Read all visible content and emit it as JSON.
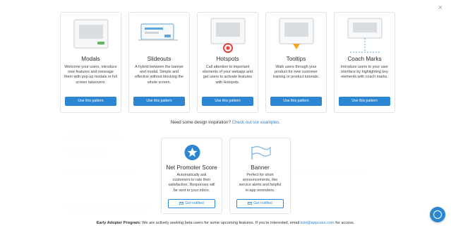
{
  "close_label": "×",
  "patterns": [
    {
      "title": "Modals",
      "desc": "Welcome your users, introduce new features and message them with pop-up modals or full screen takeovers.",
      "button": "Use this pattern",
      "icon": "modal-illustration"
    },
    {
      "title": "Slideouts",
      "desc": "A hybrid between the banner and modal. Simple and effective without blocking the whole screen.",
      "button": "Use this pattern",
      "icon": "slideout-illustration"
    },
    {
      "title": "Hotspots",
      "desc": "Call attention to important elements of your webapp and get users to activate features with Hotspots.",
      "button": "Use this pattern",
      "icon": "hotspot-illustration"
    },
    {
      "title": "Tooltips",
      "desc": "Walk users through your product for new customer training or product tutorials.",
      "button": "Use this pattern",
      "icon": "tooltip-illustration"
    },
    {
      "title": "Coach Marks",
      "desc": "Introduce users to your user interface by highlighting key elements with coach marks.",
      "button": "Use this pattern",
      "icon": "coach-marks-illustration"
    }
  ],
  "inspiration": {
    "prefix": "Need some design inspiration? ",
    "link": "Check out our examples."
  },
  "upcoming": [
    {
      "title": "Net Promoter Score",
      "desc": "Automatically ask customers to rate their satisfaction. Responses will be sent to your inbox.",
      "button": "Get notified",
      "icon": "star-badge-icon"
    },
    {
      "title": "Banner",
      "desc": "Perfect for short announcements, like service alerts and helpful in-app reminders.",
      "button": "Get notified",
      "icon": "banner-flag-icon"
    }
  ],
  "footer": {
    "label": "Early Adopter Program:",
    "text": " We are actively seeking beta users for some upcoming features. If you're interested, email ",
    "email": "tobi@appcues.com",
    "suffix": " for access."
  },
  "colors": {
    "accent": "#2d86d1",
    "hotspot": "#e8443a",
    "tooltip": "#f5a623"
  }
}
